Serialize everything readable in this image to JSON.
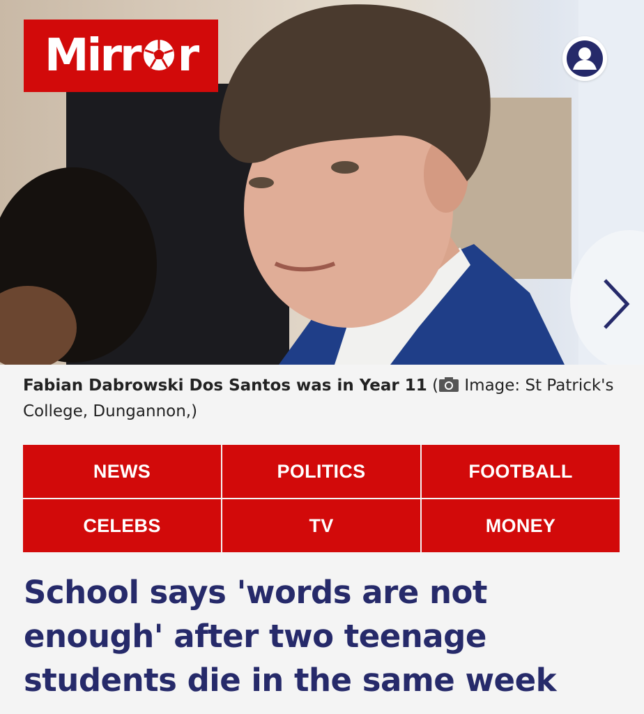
{
  "brand": {
    "logo_text_before": "Mirr",
    "logo_text_after": "r",
    "logo_bg": "#d20a0a"
  },
  "hero": {
    "account_icon": "user-account-icon",
    "next_icon": "chevron-right-icon"
  },
  "caption": {
    "name_text": "Fabian Dabrowski Dos Santos was in Year 11",
    "paren_open": " (",
    "camera_icon": "camera-icon",
    "credit_text": " Image: St Patrick's College, Dungannon,)"
  },
  "nav": {
    "items": [
      {
        "label": "NEWS"
      },
      {
        "label": "POLITICS"
      },
      {
        "label": "FOOTBALL"
      },
      {
        "label": "CELEBS"
      },
      {
        "label": "TV"
      },
      {
        "label": "MONEY"
      }
    ],
    "color": "#d20a0a"
  },
  "article": {
    "headline": "School says 'words are not enough' after two teenage students die in the same week",
    "headline_color": "#262a6a"
  }
}
